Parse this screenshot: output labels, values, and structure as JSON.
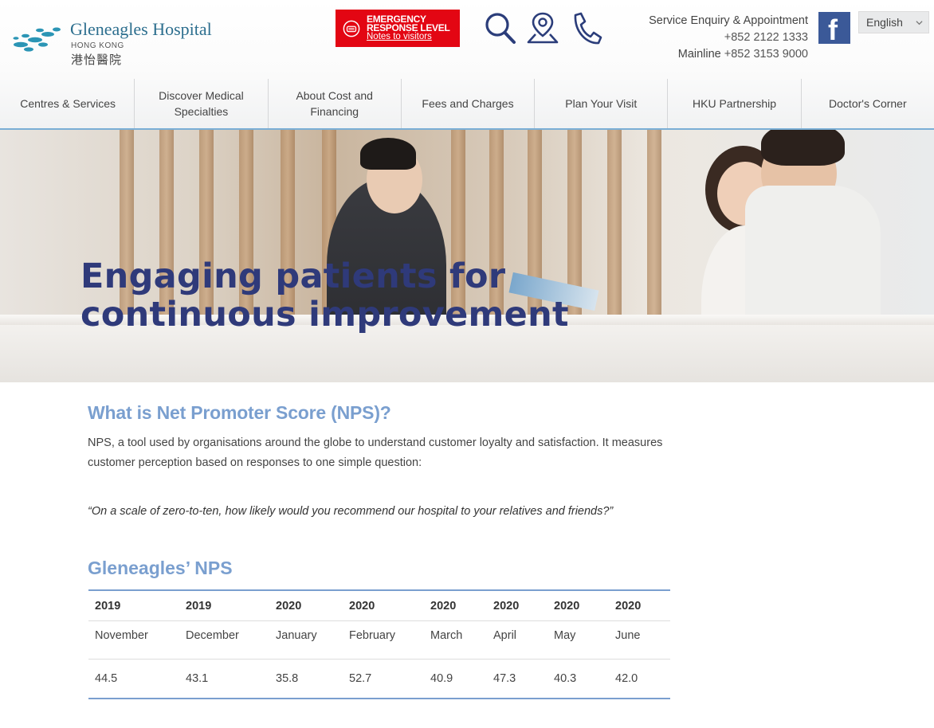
{
  "header": {
    "logo": {
      "name": "Gleneagles Hospital",
      "subtitle": "HONG KONG",
      "chinese": "港怡醫院"
    },
    "emergency": {
      "line1": "EMERGENCY",
      "line2": "RESPONSE LEVEL",
      "line3": "Notes to visitors",
      "color": "#e30613"
    },
    "icons": [
      "search-icon",
      "location-icon",
      "phone-icon"
    ],
    "contact": {
      "label1": "Service Enquiry & Appointment",
      "phone1": "+852 2122 1333",
      "label2": "Mainline",
      "phone2": "+852 3153 9000"
    },
    "facebook_glyph": "f",
    "language": "English"
  },
  "nav": {
    "items": [
      "Centres & Services",
      "Discover Medical Specialties",
      "About Cost and Financing",
      "Fees and Charges",
      "Plan Your Visit",
      "HKU Partnership",
      "Doctor's Corner"
    ]
  },
  "hero": {
    "title_line1": "Engaging patients for",
    "title_line2": "continuous improvement"
  },
  "content": {
    "heading": "What is Net Promoter Score (NPS)?",
    "description": "NPS, a tool used by organisations around the globe to understand customer loyalty and satisfaction. It measures customer perception based on responses to one simple question:",
    "quote": "“On a scale of zero-to-ten, how likely would you recommend our hospital to your relatives and friends?”",
    "nps_heading": "Gleneagles’ NPS"
  },
  "nps_table": {
    "years": [
      "2019",
      "2019",
      "2020",
      "2020",
      "2020",
      "2020",
      "2020",
      "2020"
    ],
    "months": [
      "November",
      "December",
      "January",
      "February",
      "March",
      "April",
      "May",
      "June"
    ],
    "scores": [
      "44.5",
      "43.1",
      "35.8",
      "52.7",
      "40.9",
      "47.3",
      "40.3",
      "42.0"
    ]
  },
  "colors": {
    "accent_blue": "#7a9fcf",
    "hero_title": "#2f3a7a",
    "facebook": "#3b5998",
    "nav_border": "#7aaed6"
  }
}
